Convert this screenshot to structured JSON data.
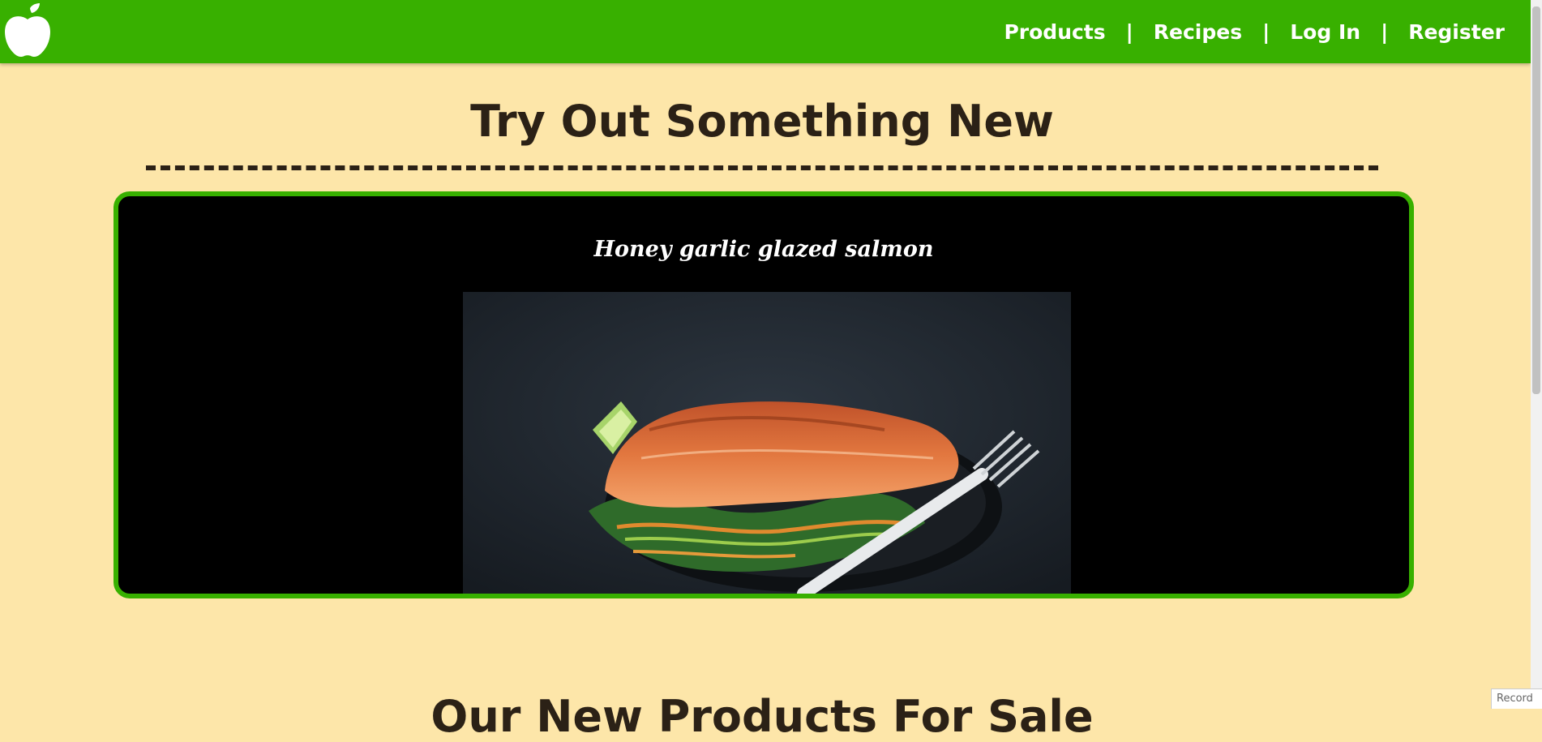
{
  "nav": {
    "items": [
      "Products",
      "Recipes",
      "Log In",
      "Register"
    ],
    "separator": "|"
  },
  "hero": {
    "title": "Try Out Something New"
  },
  "recipe_card": {
    "title": "Honey garlic glazed salmon",
    "image_icon": "salmon-plate-photo"
  },
  "next_section": {
    "title": "Our New Products For Sale"
  },
  "overlay": {
    "record_label": "Record"
  },
  "colors": {
    "header": "#38b000",
    "page_bg": "#fde6a9",
    "text": "#2b2116",
    "card_bg": "#000000"
  }
}
